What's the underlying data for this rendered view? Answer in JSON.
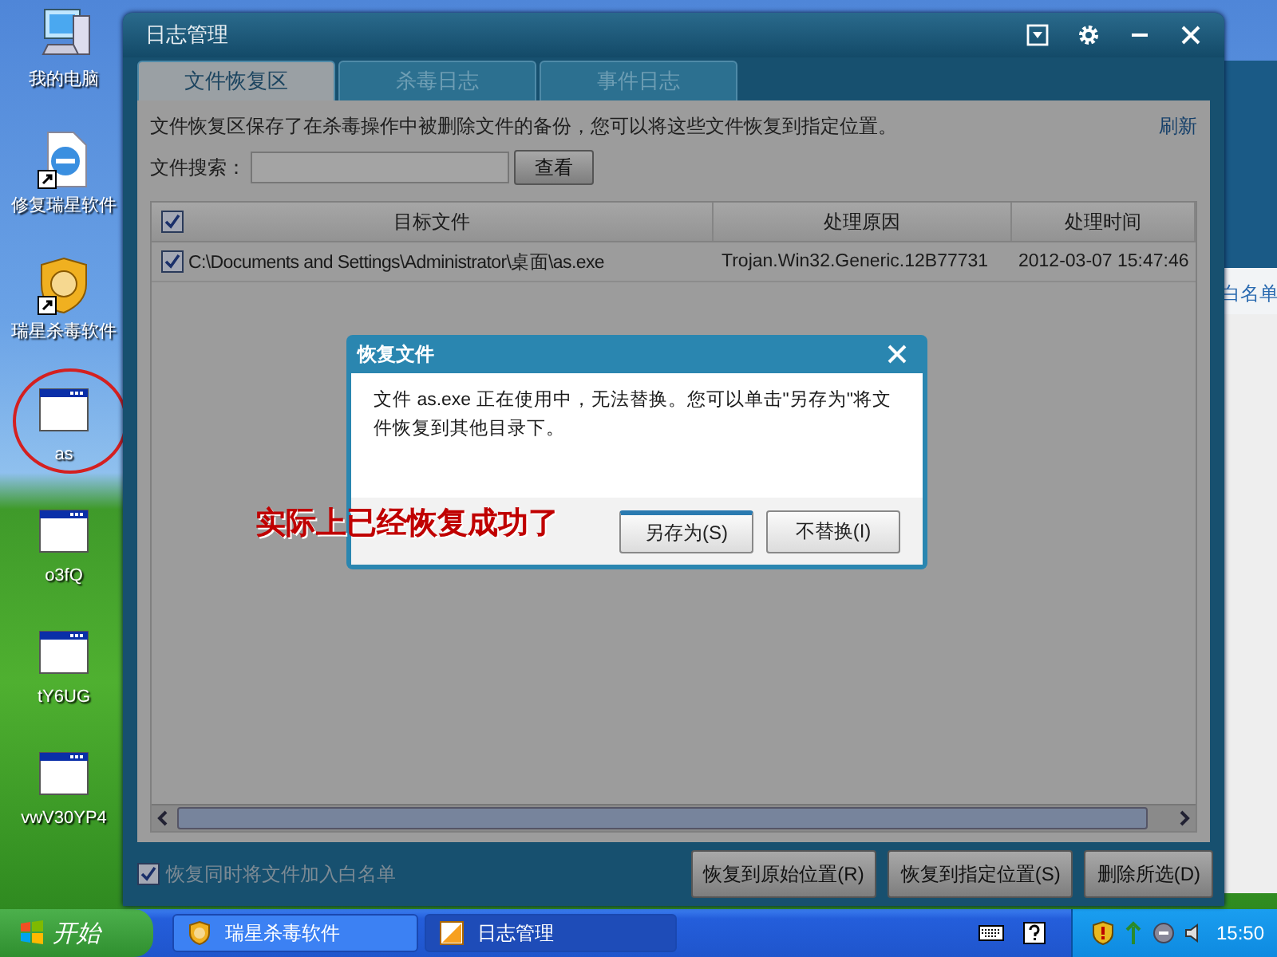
{
  "desktop_icons": [
    {
      "label": "我的电脑",
      "kind": "computer",
      "circled": false
    },
    {
      "label": "修复瑞星软件",
      "kind": "repair",
      "circled": false
    },
    {
      "label": "瑞星杀毒软件",
      "kind": "shield",
      "circled": false
    },
    {
      "label": "as",
      "kind": "app",
      "circled": true
    },
    {
      "label": "o3fQ",
      "kind": "app",
      "circled": false
    },
    {
      "label": "tY6UG",
      "kind": "app",
      "circled": false
    },
    {
      "label": "vwV30YP4",
      "kind": "app",
      "circled": false
    }
  ],
  "background_window": {
    "text": "白名单"
  },
  "window": {
    "title": "日志管理"
  },
  "tabs": [
    {
      "label": "文件恢复区",
      "selected": true
    },
    {
      "label": "杀毒日志",
      "selected": false
    },
    {
      "label": "事件日志",
      "selected": false
    }
  ],
  "description": "文件恢复区保存了在杀毒操作中被删除文件的备份，您可以将这些文件恢复到指定位置。",
  "refresh_link": "刷新",
  "search": {
    "label": "文件搜索：",
    "button": "查看"
  },
  "table": {
    "select_all_checked": true,
    "columns": [
      "目标文件",
      "处理原因",
      "处理时间"
    ],
    "rows": [
      {
        "checked": true,
        "cells": [
          "C:\\Documents and Settings\\Administrator\\桌面\\as.exe",
          "Trojan.Win32.Generic.12B77731",
          "2012-03-07 15:47:46"
        ]
      }
    ]
  },
  "whitelist_option": {
    "label": "恢复同时将文件加入白名单",
    "checked": true
  },
  "buttons": [
    "恢复到原始位置(R)",
    "恢复到指定位置(S)",
    "删除所选(D)"
  ],
  "dialog": {
    "title": "恢复文件",
    "message": "文件  as.exe 正在使用中，无法替换。您可以单击\"另存为\"将文件恢复到其他目录下。",
    "buttons": [
      {
        "label": "另存为(S)",
        "selected": true
      },
      {
        "label": "不替换(I)",
        "selected": false
      }
    ]
  },
  "annotation": "实际上已经恢复成功了",
  "taskbar": {
    "start": "开始",
    "tasks": [
      {
        "label": "瑞星杀毒软件",
        "kind": "shield",
        "selected": false
      },
      {
        "label": "日志管理",
        "kind": "log",
        "selected": true
      }
    ],
    "clock": "15:50"
  }
}
